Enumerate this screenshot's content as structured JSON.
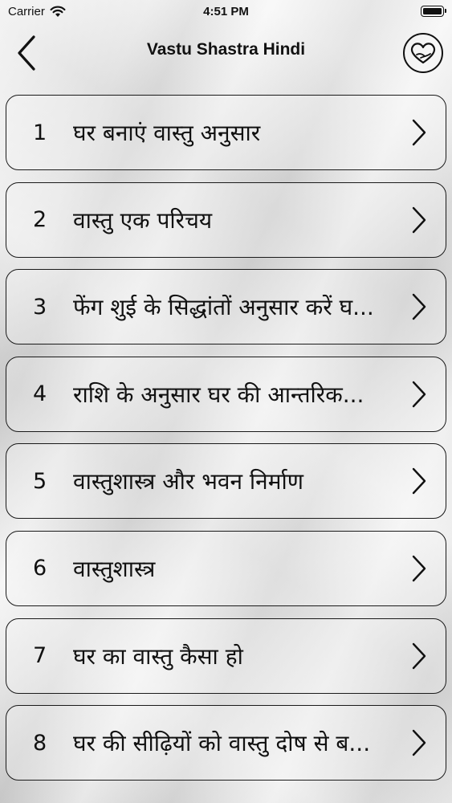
{
  "status_bar": {
    "carrier": "Carrier",
    "time": "4:51 PM",
    "icons": [
      "wifi-icon",
      "battery-icon"
    ]
  },
  "nav": {
    "title": "Vastu Shastra Hindi",
    "back_icon": "chevron-left-icon",
    "favorite_icon": "heart-icon"
  },
  "list": {
    "items": [
      {
        "number": "1",
        "title": "घर बनाएं वास्तु अनुसार"
      },
      {
        "number": "2",
        "title": "वास्तु एक परिचय"
      },
      {
        "number": "3",
        "title": "फेंग शुई के सिद्धांतों अनुसार करें घ..."
      },
      {
        "number": "4",
        "title": "राशि के अनुसार घर की आन्तरिक..."
      },
      {
        "number": "5",
        "title": "वास्तुशास्त्र और भवन निर्माण"
      },
      {
        "number": "6",
        "title": "वास्तुशास्त्र"
      },
      {
        "number": "7",
        "title": "घर का वास्तु कैसा हो"
      },
      {
        "number": "8",
        "title": "घर की सीढ़ियों को वास्तु दोष से ब..."
      }
    ],
    "chevron_icon": "chevron-right-icon"
  },
  "colors": {
    "text": "#111111",
    "border": "#1a1a1a",
    "background": "#e6e6e6"
  }
}
